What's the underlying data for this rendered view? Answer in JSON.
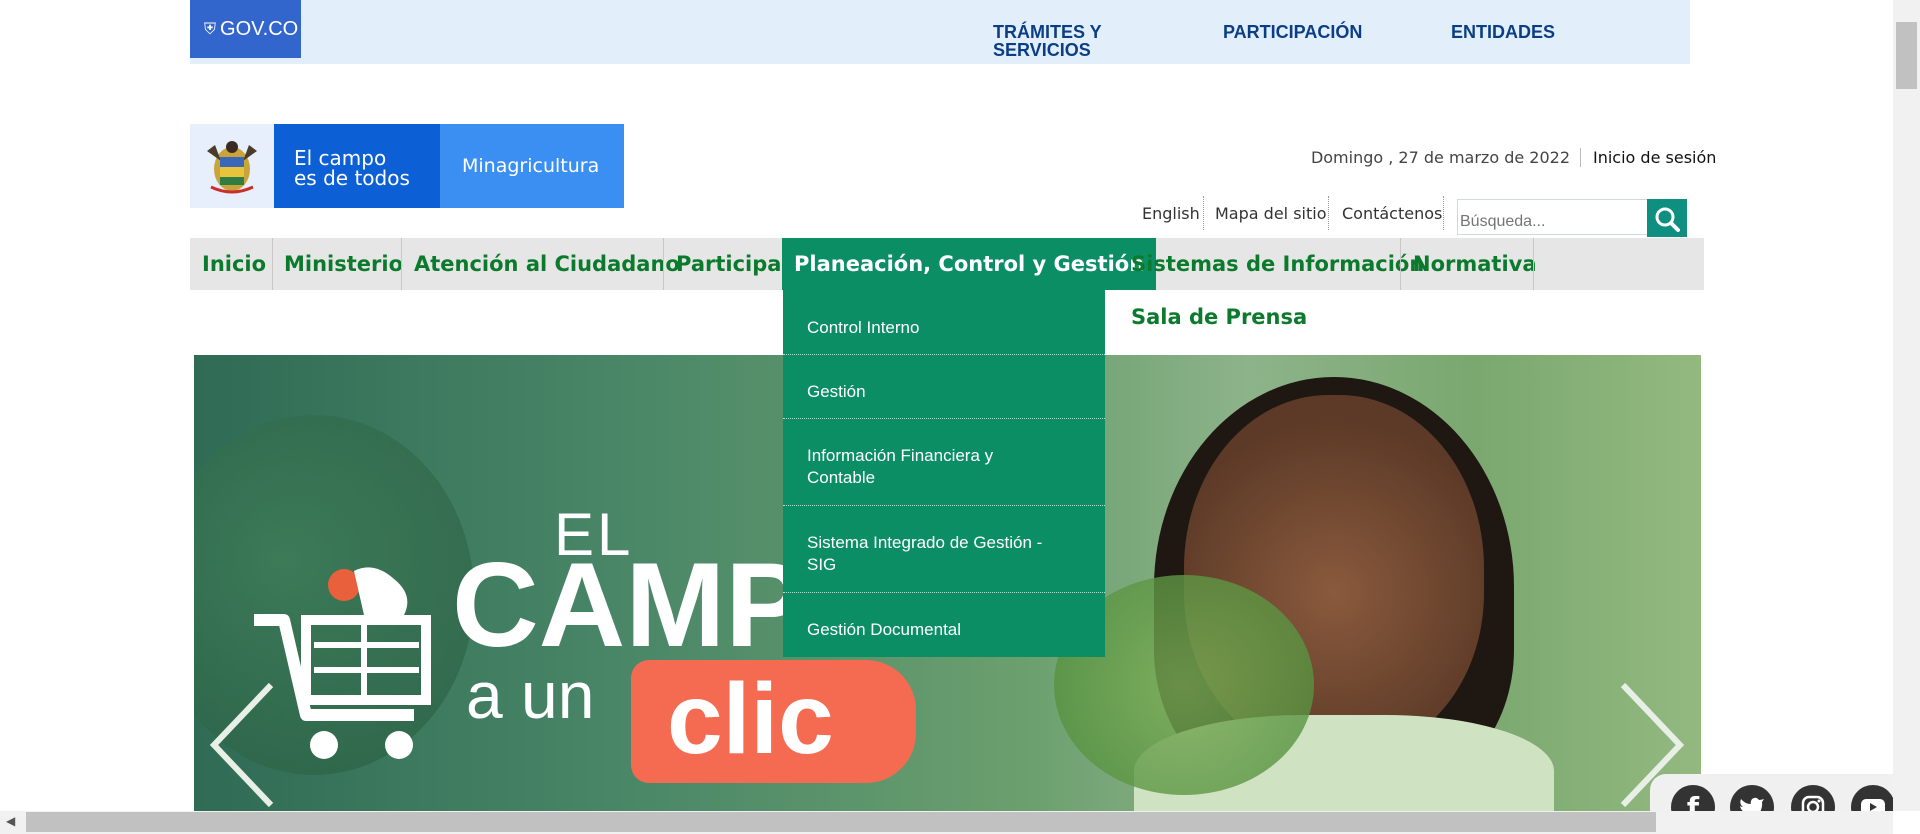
{
  "gov_bar": {
    "logo_text": "GOV.CO",
    "links": [
      "TRÁMITES Y",
      "SERVICIOS",
      "PARTICIPACIÓN",
      "ENTIDADES"
    ]
  },
  "brand": {
    "campo_line1": "El campo",
    "campo_line2": "es de todos",
    "ministry": "Minagricultura"
  },
  "header": {
    "date": "Domingo , 27 de marzo de 2022",
    "login": "Inicio de sesión"
  },
  "utility_links": [
    "English",
    "Mapa del sitio",
    "Contáctenos"
  ],
  "search": {
    "placeholder": "Búsqueda..."
  },
  "nav": {
    "items": [
      "Inicio",
      "Ministerio",
      "Atención al Ciudadano",
      "Participa",
      "Planeación, Control y Gestión",
      "Sistemas de Información",
      "Normativa",
      "Sala de Prensa"
    ],
    "active_index": 4
  },
  "dropdown": {
    "items": [
      "Control Interno",
      "Gestión",
      "Información Financiera y",
      "Contable",
      "Sistema Integrado de Gestión -",
      "SIG",
      "Gestión Documental"
    ]
  },
  "hero": {
    "line_el": "EL",
    "line_campo": "CAMP",
    "line_aun": "a un",
    "line_clic": "clic"
  },
  "social": [
    "facebook-icon",
    "twitter-icon",
    "instagram-icon",
    "youtube-icon"
  ],
  "colors": {
    "gov_blue": "#3366cc",
    "nav_green": "#0c7a2d",
    "active_green": "#0c8e65",
    "clic_orange": "#f46b52"
  }
}
